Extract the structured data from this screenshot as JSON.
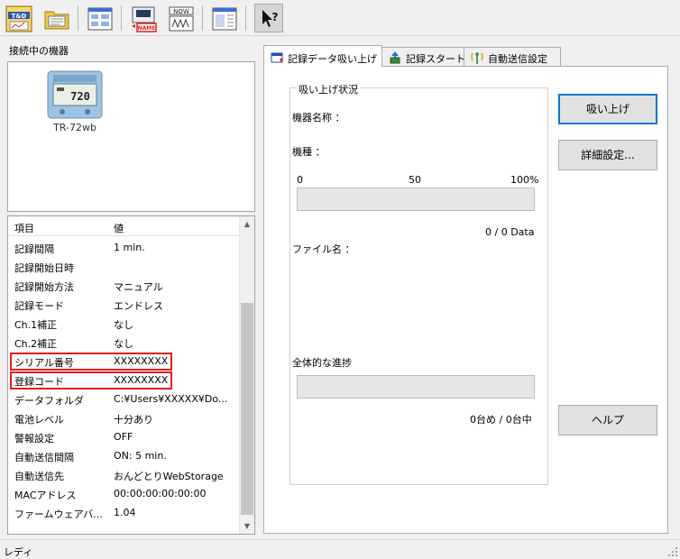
{
  "left_panel": {
    "connected_label": "接続中の機器",
    "device": {
      "name": "TR-72wb",
      "screen_text": "720"
    }
  },
  "properties": {
    "headers": {
      "item": "項目",
      "value": "値"
    },
    "rows": [
      {
        "key": "記録間隔",
        "value": "1 min."
      },
      {
        "key": "記録開始日時",
        "value": ""
      },
      {
        "key": "記録開始方法",
        "value": "マニュアル"
      },
      {
        "key": "記録モード",
        "value": "エンドレス"
      },
      {
        "key": "Ch.1補正",
        "value": "なし"
      },
      {
        "key": "Ch.2補正",
        "value": "なし"
      },
      {
        "key": "シリアル番号",
        "value": "XXXXXXXX"
      },
      {
        "key": "登録コード",
        "value": "XXXXXXXX"
      },
      {
        "key": "データフォルダ",
        "value": "C:¥Users¥XXXXX¥Do..."
      },
      {
        "key": "電池レベル",
        "value": "十分あり"
      },
      {
        "key": "警報設定",
        "value": "OFF"
      },
      {
        "key": "自動送信間隔",
        "value": "ON: 5 min."
      },
      {
        "key": "自動送信先",
        "value": "おんどとりWebStorage"
      },
      {
        "key": "MACアドレス",
        "value": "00:00:00:00:00:00"
      },
      {
        "key": "ファームウェアバ...",
        "value": "1.04"
      }
    ]
  },
  "tabs": [
    {
      "label": "記録データ吸い上げ",
      "active": true
    },
    {
      "label": "記録スタート",
      "active": false
    },
    {
      "label": "自動送信設定",
      "active": false
    }
  ],
  "download": {
    "group_title": "吸い上げ状況",
    "device_name_label": "機器名称 ：",
    "model_label": "機種 ：",
    "scale": {
      "min": "0",
      "mid": "50",
      "max": "100%"
    },
    "progress_fraction": 0,
    "data_count": "0 / 0 Data",
    "file_name_label": "ファイル名 ：",
    "overall_label": "全体的な進捗",
    "overall_fraction": 0,
    "unit_count": "0台め / 0台中"
  },
  "buttons": {
    "download": "吸い上げ",
    "details": "詳細設定...",
    "help": "ヘルプ"
  },
  "toolbar": {
    "items": [
      "tandd-logo-icon",
      "open-folder-icon",
      "data-list-icon",
      "device-name-icon",
      "now-graph-icon",
      "table-window-icon",
      "help-cursor-icon"
    ],
    "now_text": "NOW",
    "name_text": "NAME"
  },
  "status": {
    "text": "レディ"
  },
  "colors": {
    "highlight": "#e01e1e",
    "focus": "#0078d7"
  }
}
